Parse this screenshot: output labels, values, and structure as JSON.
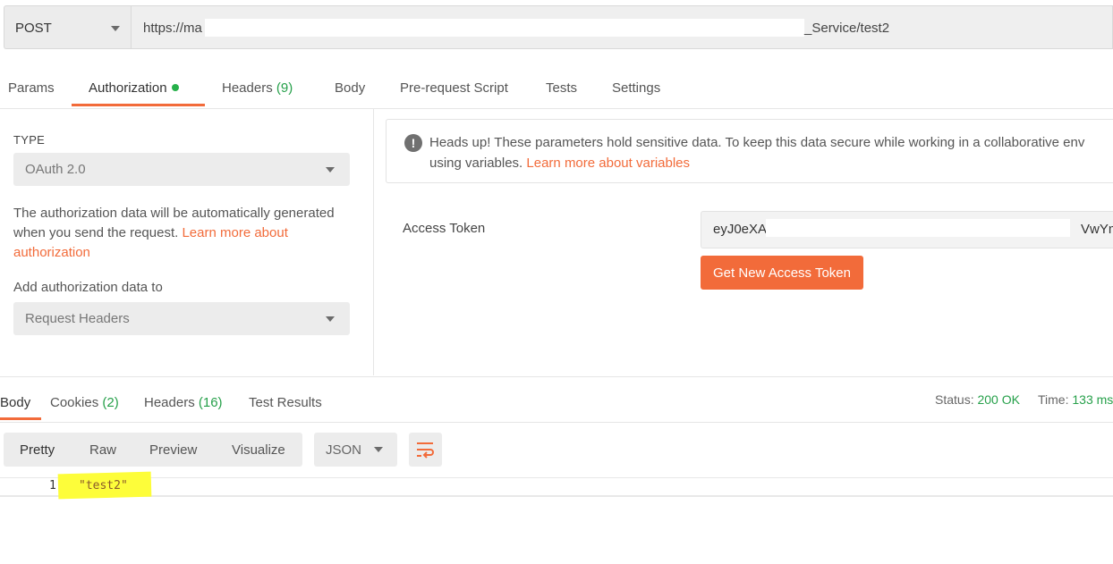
{
  "request": {
    "method": "POST",
    "url_start": "https://ma",
    "url_end": "_Service/test2"
  },
  "tabs": [
    {
      "label": "Params"
    },
    {
      "label": "Authorization"
    },
    {
      "label": "Headers",
      "count": "(9)"
    },
    {
      "label": "Body"
    },
    {
      "label": "Pre-request Script"
    },
    {
      "label": "Tests"
    },
    {
      "label": "Settings"
    }
  ],
  "auth": {
    "type_label": "TYPE",
    "type_value": "OAuth 2.0",
    "description": "The authorization data will be automatically generated when you send the request.",
    "learn_more": "Learn more about authorization",
    "add_to_label": "Add authorization data to",
    "add_to_value": "Request Headers"
  },
  "notice": {
    "text": "Heads up! These parameters hold sensitive data. To keep this data secure while working in a collaborative env",
    "text2": "using variables.",
    "link": "Learn more about variables"
  },
  "token": {
    "label": "Access Token",
    "value_start": "eyJ0eXAi(",
    "value_end": "VwYm",
    "button": "Get New Access Token"
  },
  "response": {
    "tabs": [
      {
        "label": "Body"
      },
      {
        "label": "Cookies",
        "count": "(2)"
      },
      {
        "label": "Headers",
        "count": "(16)"
      },
      {
        "label": "Test Results"
      }
    ],
    "status_label": "Status:",
    "status_value": "200 OK",
    "time_label": "Time:",
    "time_value": "133 ms",
    "views": [
      "Pretty",
      "Raw",
      "Preview",
      "Visualize"
    ],
    "format": "JSON",
    "line_number": "1",
    "code": "\"test2\""
  },
  "colors": {
    "accent": "#f26b3a",
    "success": "#26a04a",
    "highlight": "#fdfd3a"
  }
}
